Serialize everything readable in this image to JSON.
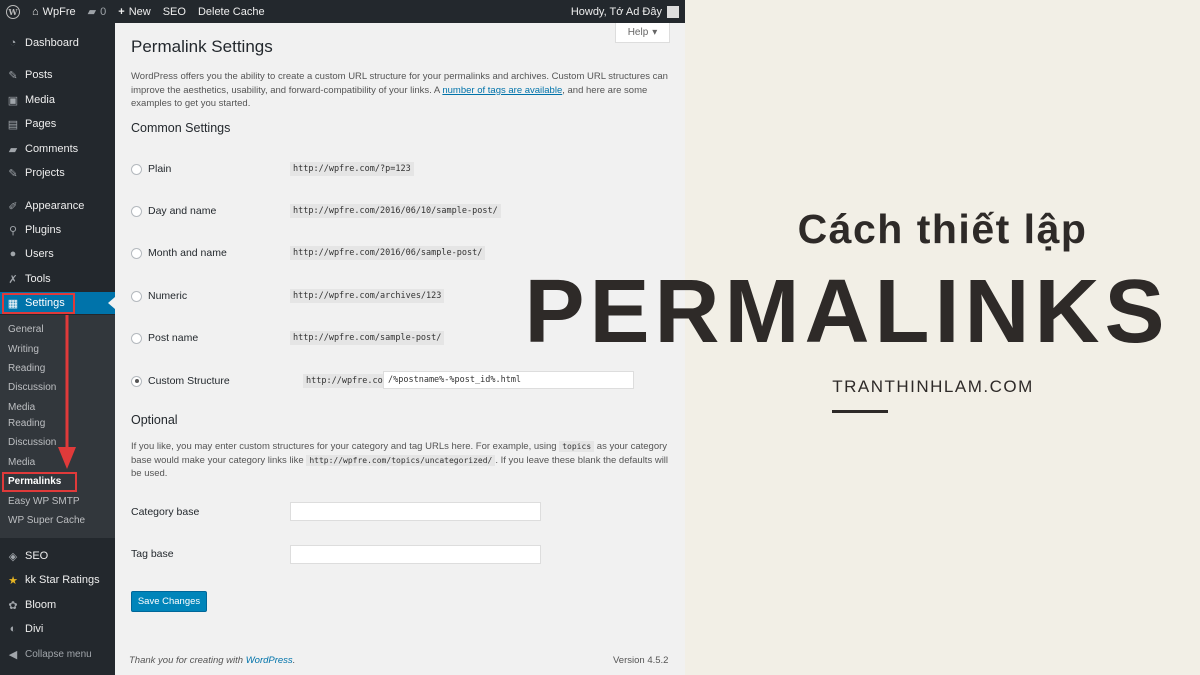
{
  "adminbar": {
    "site_name": "WpFre",
    "comments_count": "0",
    "new_label": "New",
    "seo_label": "SEO",
    "delete_cache_label": "Delete Cache",
    "howdy": "Howdy, Tớ Ad Đây"
  },
  "sidebar": {
    "items": [
      {
        "label": "Dashboard",
        "icon": "dashboard-icon"
      },
      {
        "label": "Posts",
        "icon": "pin-icon"
      },
      {
        "label": "Media",
        "icon": "media-icon"
      },
      {
        "label": "Pages",
        "icon": "pages-icon"
      },
      {
        "label": "Comments",
        "icon": "comment-icon"
      },
      {
        "label": "Projects",
        "icon": "pin-icon"
      },
      {
        "label": "Appearance",
        "icon": "brush-icon"
      },
      {
        "label": "Plugins",
        "icon": "plugin-icon"
      },
      {
        "label": "Users",
        "icon": "user-icon"
      },
      {
        "label": "Tools",
        "icon": "wrench-icon"
      },
      {
        "label": "Settings",
        "icon": "settings-icon"
      },
      {
        "label": "SEO",
        "icon": "seo-icon"
      },
      {
        "label": "kk Star Ratings",
        "icon": "star-icon"
      },
      {
        "label": "Bloom",
        "icon": "bloom-icon"
      },
      {
        "label": "Divi",
        "icon": "divi-icon"
      },
      {
        "label": "Collapse menu",
        "icon": "collapse-icon"
      }
    ],
    "submenu": [
      "General",
      "Writing",
      "Reading",
      "Discussion",
      "Media",
      "Reading",
      "Discussion",
      "Media",
      "Permalinks",
      "Easy WP SMTP",
      "WP Super Cache"
    ],
    "accent_color": "#0073aa",
    "highlight_color": "#e03a3a"
  },
  "content": {
    "help_label": "Help",
    "title": "Permalink Settings",
    "intro_before_link": "WordPress offers you the ability to create a custom URL structure for your permalinks and archives. Custom URL structures can improve the aesthetics, usability, and forward-compatibility of your links. A ",
    "intro_link": "number of tags are available",
    "intro_after_link": ", and here are some examples to get you started.",
    "common_heading": "Common Settings",
    "options": [
      {
        "label": "Plain",
        "example": "http://wpfre.com/?p=123"
      },
      {
        "label": "Day and name",
        "example": "http://wpfre.com/2016/06/10/sample-post/"
      },
      {
        "label": "Month and name",
        "example": "http://wpfre.com/2016/06/sample-post/"
      },
      {
        "label": "Numeric",
        "example": "http://wpfre.com/archives/123"
      },
      {
        "label": "Post name",
        "example": "http://wpfre.com/sample-post/"
      },
      {
        "label": "Custom Structure",
        "example": "http://wpfre.com",
        "value": "/%postname%-%post_id%.html"
      }
    ],
    "selected_option": "Custom Structure",
    "optional_heading": "Optional",
    "optional_text_1": "If you like, you may enter custom structures for your category and tag URLs here. For example, using ",
    "optional_code_1": "topics",
    "optional_text_2": " as your category base would make your category links like ",
    "optional_code_2": "http://wpfre.com/topics/uncategorized/",
    "optional_text_3": ". If you leave these blank the defaults will be used.",
    "category_base_label": "Category base",
    "category_base_value": "",
    "tag_base_label": "Tag base",
    "tag_base_value": "",
    "save_label": "Save Changes",
    "footer_text": "Thank you for creating with ",
    "footer_link": "WordPress",
    "footer_dot": ".",
    "version": "Version 4.5.2"
  },
  "poster": {
    "subtitle": "Cách thiết lập",
    "title": "PERMALINKS",
    "site": "TRANTHINHLAM.COM",
    "background_color": "#f2efe6",
    "text_color": "#2e2a28"
  }
}
